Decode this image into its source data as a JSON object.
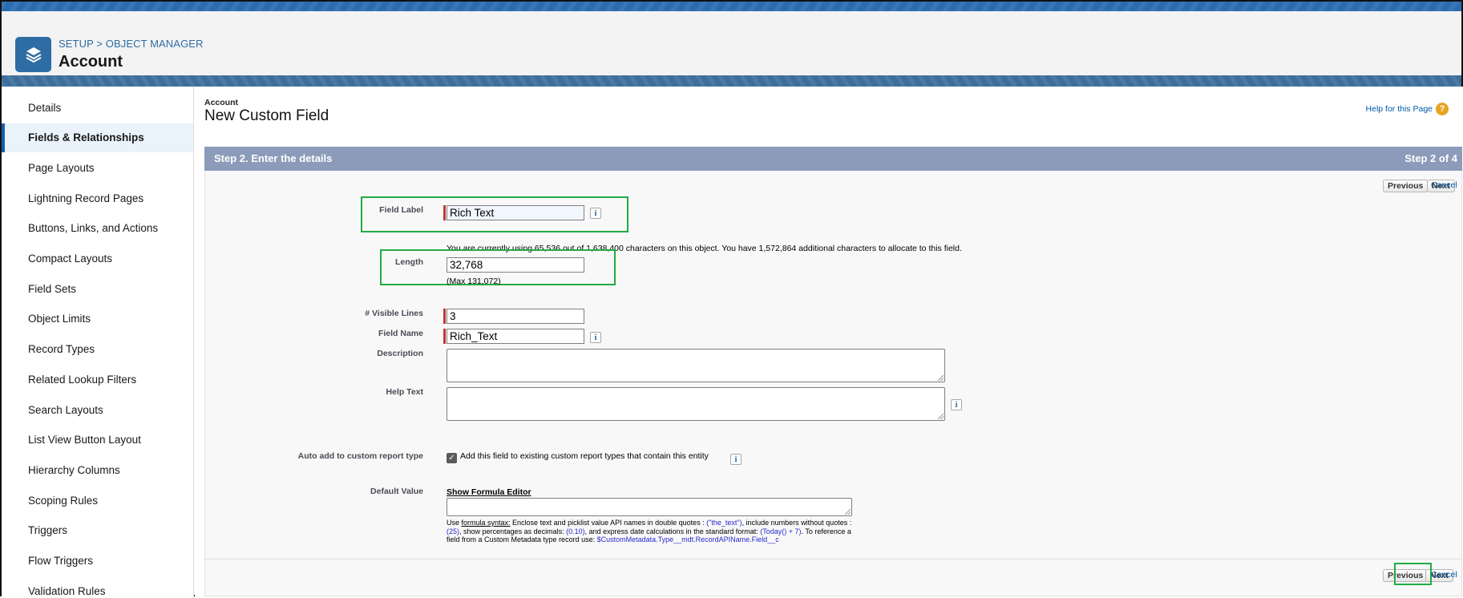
{
  "header": {
    "breadcrumb_setup": "SETUP",
    "breadcrumb_sep": ">",
    "breadcrumb_object_manager": "OBJECT MANAGER",
    "title": "Account",
    "icon": "layers-icon"
  },
  "sidebar": {
    "items": [
      {
        "label": "Details"
      },
      {
        "label": "Fields & Relationships",
        "active": true
      },
      {
        "label": "Page Layouts"
      },
      {
        "label": "Lightning Record Pages"
      },
      {
        "label": "Buttons, Links, and Actions"
      },
      {
        "label": "Compact Layouts"
      },
      {
        "label": "Field Sets"
      },
      {
        "label": "Object Limits"
      },
      {
        "label": "Record Types"
      },
      {
        "label": "Related Lookup Filters"
      },
      {
        "label": "Search Layouts"
      },
      {
        "label": "List View Button Layout"
      },
      {
        "label": "Hierarchy Columns"
      },
      {
        "label": "Scoping Rules"
      },
      {
        "label": "Triggers"
      },
      {
        "label": "Flow Triggers"
      },
      {
        "label": "Validation Rules"
      }
    ]
  },
  "main": {
    "object_label": "Account",
    "title": "New Custom Field",
    "help_link": "Help for this Page",
    "step_title": "Step 2. Enter the details",
    "step_count": "Step 2 of 4",
    "buttons": {
      "previous": "Previous",
      "next": "Next",
      "cancel": "Cancel"
    },
    "form": {
      "field_label": {
        "label": "Field Label",
        "value": "Rich Text"
      },
      "usage_note": "You are currently using 65,536 out of 1,638,400 characters on this object. You have 1,572,864 additional characters to allocate to this field.",
      "length": {
        "label": "Length",
        "value": "32,768",
        "max_note": "(Max 131,072)"
      },
      "visible_lines": {
        "label": "# Visible Lines",
        "value": "3"
      },
      "field_name": {
        "label": "Field Name",
        "value": "Rich_Text"
      },
      "description": {
        "label": "Description",
        "value": ""
      },
      "help_text": {
        "label": "Help Text",
        "value": ""
      },
      "auto_add": {
        "label": "Auto add to custom report type",
        "checkbox_label": "Add this field to existing custom report types that contain this entity",
        "checked": true
      },
      "default_value": {
        "label": "Default Value",
        "formula_link": "Show Formula Editor",
        "hint_use": "Use ",
        "hint_formula_syntax": "formula syntax:",
        "hint_p1": " Enclose text and picklist value API names in double quotes : ",
        "hint_ex1": "(\"the_text\")",
        "hint_p2": ", include numbers without quotes : ",
        "hint_ex2": "(25)",
        "hint_p3": ", show percentages as decimals: ",
        "hint_ex3": "(0.10)",
        "hint_p4": ", and express date calculations in the standard format: ",
        "hint_ex4": "(Today() + 7)",
        "hint_p5": ". To reference a field from a Custom Metadata type record use: ",
        "hint_ex5": "$CustomMetadata.Type__mdt.RecordAPIName.Field__c"
      }
    }
  }
}
